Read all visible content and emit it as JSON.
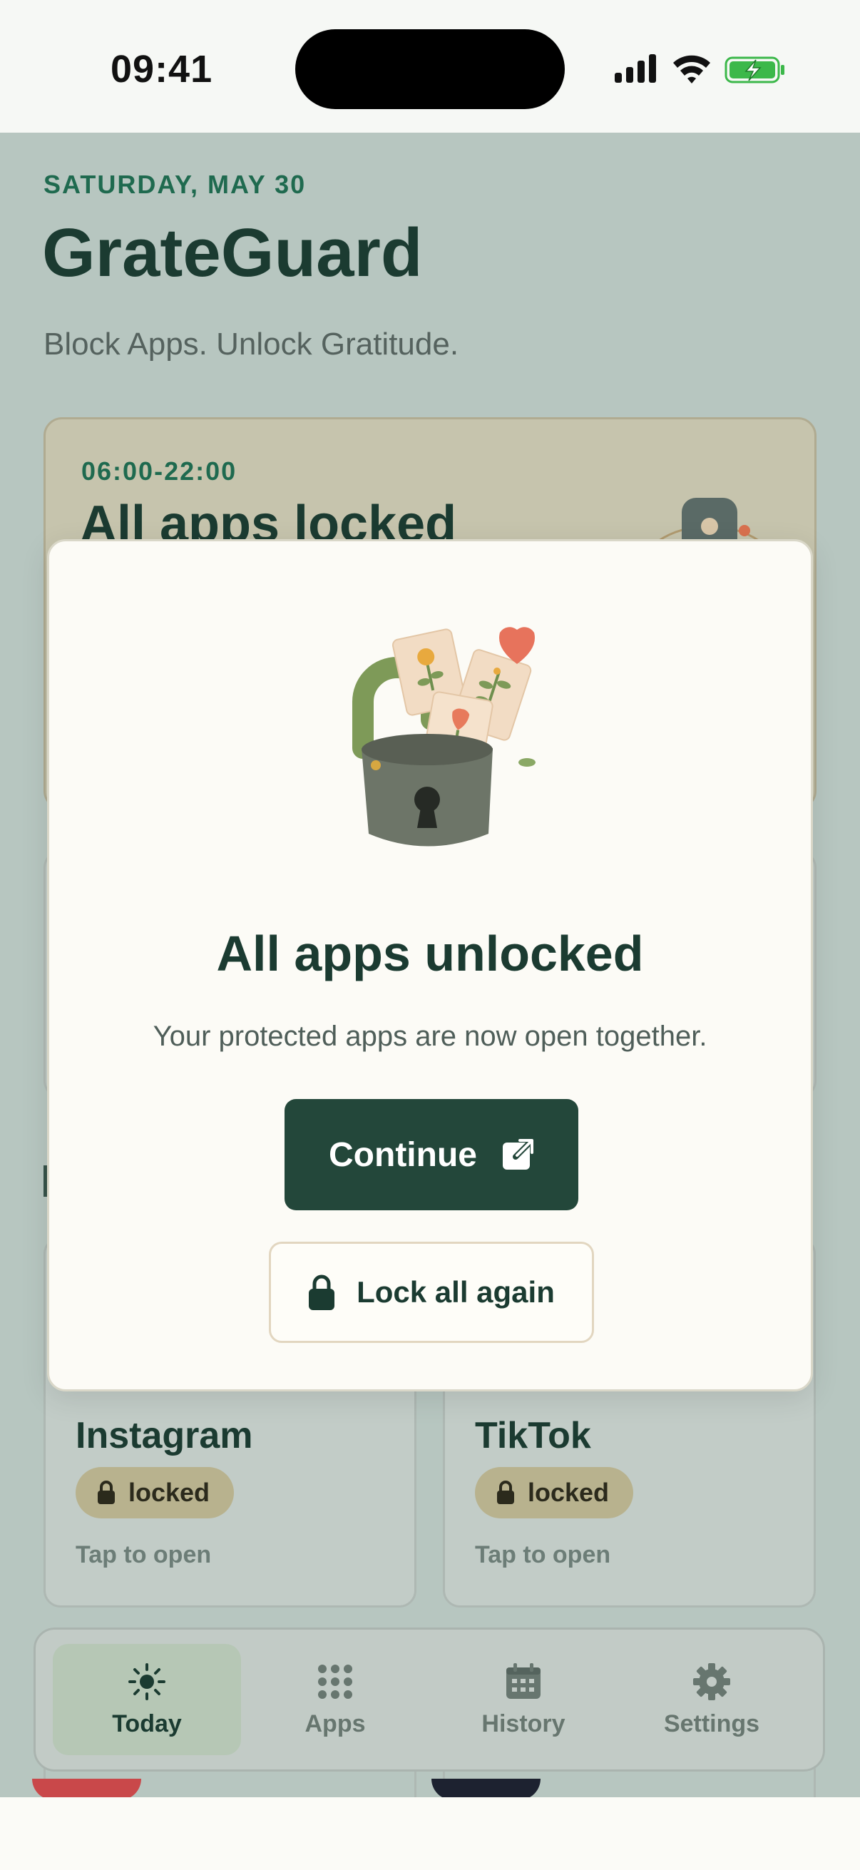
{
  "status_bar": {
    "time": "09:41"
  },
  "header": {
    "date": "SATURDAY, MAY 30",
    "title": "GrateGuard",
    "subtitle": "Block Apps. Unlock Gratitude."
  },
  "schedule_card": {
    "time_range": "06:00-22:00",
    "status": "All apps locked"
  },
  "apps": [
    {
      "name": "Instagram",
      "badge": "locked",
      "hint": "Tap to open"
    },
    {
      "name": "TikTok",
      "badge": "locked",
      "hint": "Tap to open"
    }
  ],
  "tab_bar": {
    "items": [
      {
        "label": "Today",
        "icon": "sun-icon",
        "active": true
      },
      {
        "label": "Apps",
        "icon": "grid-icon",
        "active": false
      },
      {
        "label": "History",
        "icon": "calendar-icon",
        "active": false
      },
      {
        "label": "Settings",
        "icon": "gear-icon",
        "active": false
      }
    ]
  },
  "modal": {
    "title": "All apps unlocked",
    "message": "Your protected apps are now open together.",
    "primary_button": "Continue",
    "secondary_button": "Lock all again"
  },
  "colors": {
    "primary": "#23473a",
    "accent_green": "#1f6a4f",
    "dim_background": "#b7c6c0",
    "modal_background": "#fcfbf6",
    "locked_pill": "#b8b28e"
  }
}
